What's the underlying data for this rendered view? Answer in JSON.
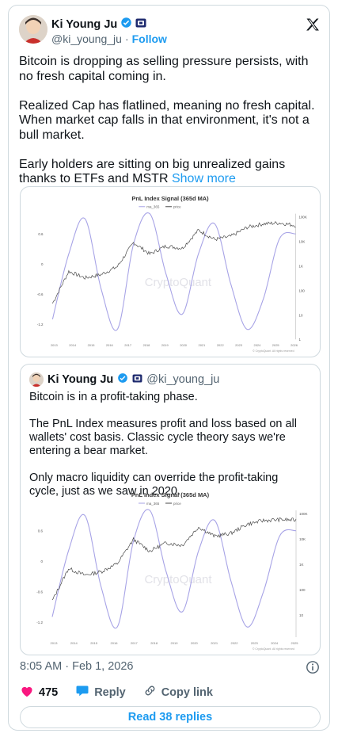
{
  "author": {
    "name": "Ki Young Ju",
    "handle": "@ki_young_ju",
    "follow_label": "Follow"
  },
  "tweet": {
    "paragraphs": [
      "Bitcoin is dropping as selling pressure persists, with no fresh capital coming in.",
      "Realized Cap has flatlined, meaning no fresh capital. When market cap falls in that environment, it's not a bull market.",
      "Early holders are sitting on big unrealized gains thanks to ETFs and MSTR"
    ],
    "show_more_label": "Show more"
  },
  "quote": {
    "name": "Ki Young Ju",
    "handle": "@ki_young_ju",
    "paragraphs": [
      "Bitcoin is in a profit-taking phase.",
      "The PnL Index measures profit and loss based on all wallets' cost basis. Classic cycle theory says we're entering a bear market.",
      "Only macro liquidity can override the profit-taking cycle, just as we saw in 2020."
    ]
  },
  "footer": {
    "timestamp": "8:05 AM · Feb 1, 2026",
    "likes": "475",
    "reply_label": "Reply",
    "copy_link_label": "Copy link",
    "read_replies_label": "Read 38 replies"
  },
  "colors": {
    "accent": "#1d9bf0",
    "like": "#f91880",
    "signal_line": "#a7a3e6",
    "price_line": "#4a4a4a"
  },
  "chart_data": [
    {
      "type": "line",
      "title": "PnL Index Signal (365d MA)",
      "legend": [
        "ma_365",
        "price"
      ],
      "legend_position": "top-center",
      "watermark": "CryptoQuant",
      "footnote": "© CryptoQuant. All rights reserved",
      "x": [
        2013,
        2014,
        2015,
        2016,
        2017,
        2018,
        2019,
        2020,
        2021,
        2022,
        2023,
        2024,
        2025,
        2026
      ],
      "x_tick_labels": [
        "2013",
        "2014",
        "2015",
        "2016",
        "2017",
        "2018",
        "2019",
        "2020",
        "2021",
        "2022",
        "2023",
        "2024",
        "2025",
        "2026"
      ],
      "y_left_ticks": [
        "0.6",
        "0",
        "-0.6",
        "-1.2"
      ],
      "y_left_range": [
        -1.5,
        1.0
      ],
      "y_right_ticks": [
        "100K",
        "10K",
        "1K",
        "100",
        "10",
        "1"
      ],
      "series": [
        {
          "name": "ma_365",
          "values": [
            -1.1,
            0.2,
            0.9,
            -0.5,
            -1.3,
            0.4,
            1.0,
            -0.2,
            -1.0,
            0.2,
            0.8,
            -0.4,
            -1.3,
            -0.7,
            0.5,
            0.6
          ]
        },
        {
          "name": "price",
          "values": [
            20,
            600,
            300,
            430,
            1000,
            13000,
            3800,
            9000,
            7000,
            48000,
            18000,
            25000,
            65000,
            95000,
            105000,
            80000
          ]
        }
      ]
    },
    {
      "type": "line",
      "title": "PnL Index Signal (365d MA)",
      "legend": [
        "ma_365",
        "price"
      ],
      "legend_position": "top-center",
      "watermark": "CryptoQuant",
      "footnote": "© CryptoQuant. All rights reserved",
      "x": [
        2013,
        2014,
        2015,
        2016,
        2017,
        2018,
        2019,
        2020,
        2021,
        2022,
        2023,
        2024,
        2025
      ],
      "x_tick_labels": [
        "2013",
        "2014",
        "2015",
        "2016",
        "2017",
        "2018",
        "2019",
        "2020",
        "2021",
        "2022",
        "2023",
        "2024",
        "2025"
      ],
      "y_left_ticks": [
        "0.6",
        "0",
        "-0.6",
        "-1.2"
      ],
      "y_left_range": [
        -1.5,
        1.0
      ],
      "y_right_ticks": [
        "100K",
        "10K",
        "1K",
        "100",
        "10"
      ],
      "series": [
        {
          "name": "ma_365",
          "values": [
            -1.1,
            0.2,
            0.9,
            -0.5,
            -1.3,
            0.4,
            1.0,
            -0.2,
            -1.0,
            0.2,
            0.8,
            -0.4,
            -1.3,
            -0.6,
            0.5,
            0.6
          ]
        },
        {
          "name": "price",
          "values": [
            20,
            600,
            300,
            430,
            1000,
            13000,
            3800,
            9000,
            7000,
            48000,
            18000,
            25000,
            65000,
            95000,
            105000,
            100000
          ]
        }
      ]
    }
  ]
}
